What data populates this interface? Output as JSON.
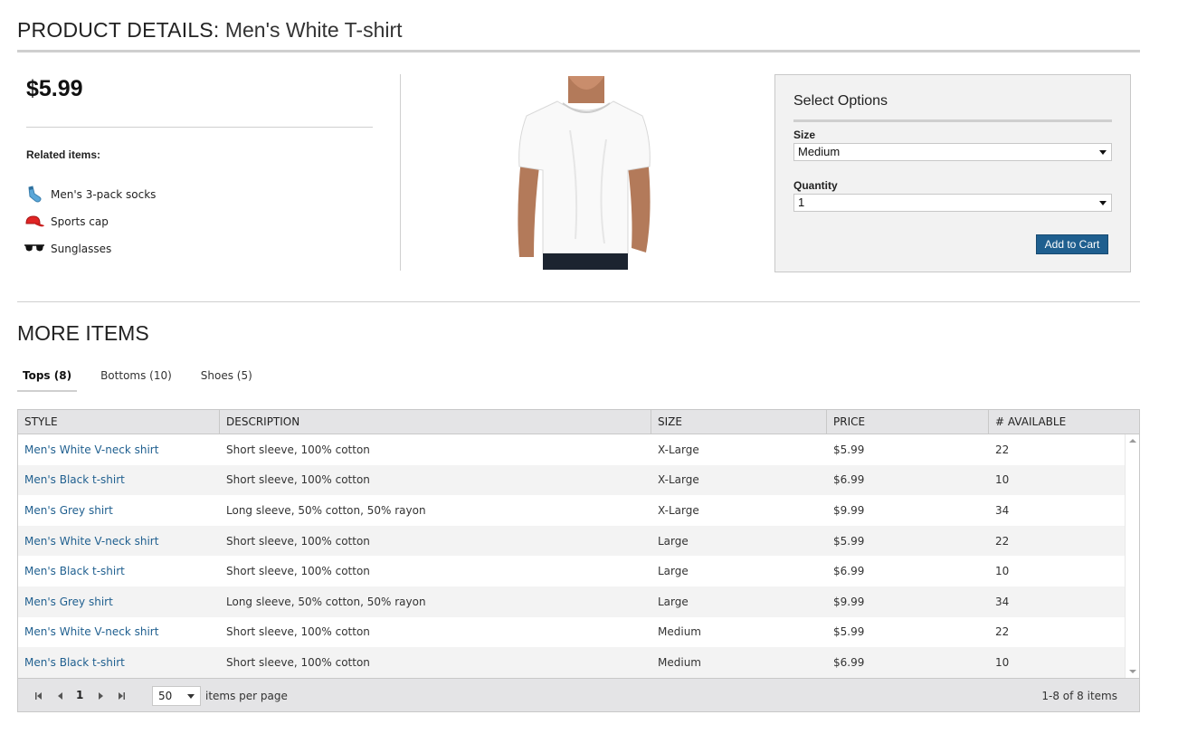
{
  "header": {
    "title_strong": "PRODUCT DETAILS:",
    "title_product": " Men's White T-shirt"
  },
  "product": {
    "price": "$5.99",
    "image_name": "white-tshirt-photo"
  },
  "related": {
    "title": "Related items:",
    "items": [
      {
        "label": "Men's 3-pack socks",
        "icon": "socks-icon"
      },
      {
        "label": "Sports cap",
        "icon": "cap-icon"
      },
      {
        "label": "Sunglasses",
        "icon": "sunglasses-icon"
      }
    ]
  },
  "options": {
    "title": "Select Options",
    "size_label": "Size",
    "size_value": "Medium",
    "quantity_label": "Quantity",
    "quantity_value": "1",
    "add_to_cart": "Add to Cart",
    "button_color": "#1f5f8f"
  },
  "more_items": {
    "title": "MORE ITEMS",
    "tabs": [
      {
        "label": "Tops (8)",
        "active": true
      },
      {
        "label": "Bottoms (10)",
        "active": false
      },
      {
        "label": "Shoes (5)",
        "active": false
      }
    ]
  },
  "grid": {
    "columns": [
      "STYLE",
      "DESCRIPTION",
      "SIZE",
      "PRICE",
      "# AVAILABLE"
    ],
    "rows": [
      [
        "Men's White V-neck shirt",
        "Short sleeve, 100% cotton",
        "X-Large",
        "$5.99",
        "22"
      ],
      [
        "Men's Black t-shirt",
        "Short sleeve, 100% cotton",
        "X-Large",
        "$6.99",
        "10"
      ],
      [
        "Men's Grey shirt",
        "Long sleeve, 50% cotton, 50% rayon",
        "X-Large",
        "$9.99",
        "34"
      ],
      [
        "Men's White V-neck shirt",
        "Short sleeve, 100% cotton",
        "Large",
        "$5.99",
        "22"
      ],
      [
        "Men's Black t-shirt",
        "Short sleeve, 100% cotton",
        "Large",
        "$6.99",
        "10"
      ],
      [
        "Men's Grey shirt",
        "Long sleeve, 50% cotton, 50% rayon",
        "Large",
        "$9.99",
        "34"
      ],
      [
        "Men's White V-neck shirt",
        "Short sleeve, 100% cotton",
        "Medium",
        "$5.99",
        "22"
      ],
      [
        "Men's Black t-shirt",
        "Short sleeve, 100% cotton",
        "Medium",
        "$6.99",
        "10"
      ]
    ],
    "link_color": "#1f5f8f"
  },
  "pager": {
    "current_page": "1",
    "page_size": "50",
    "items_per_page_label": "items per page",
    "info": "1-8 of 8 items"
  }
}
